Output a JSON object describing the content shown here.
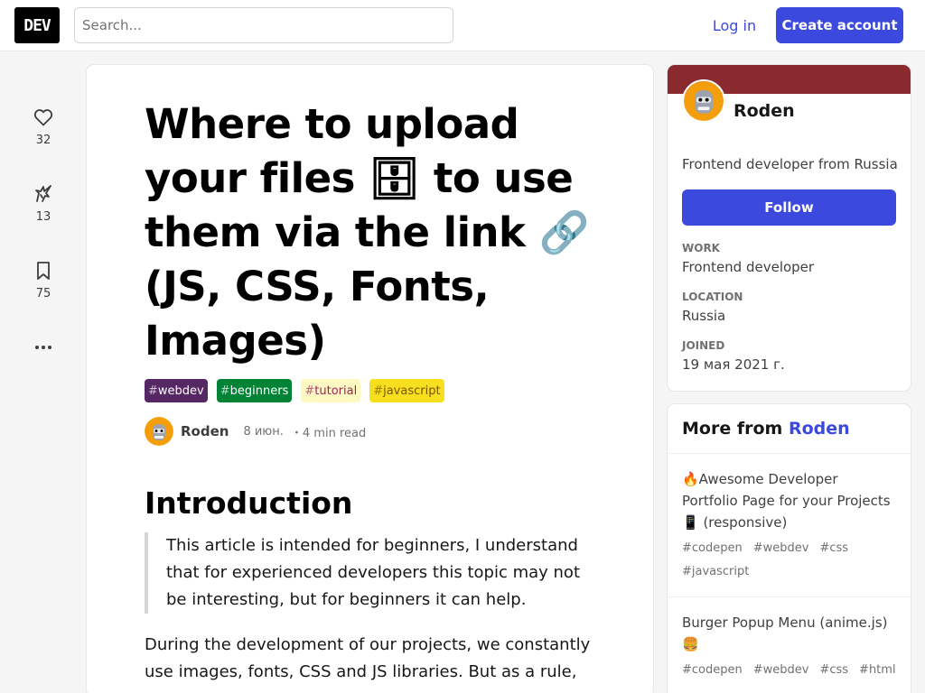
{
  "header": {
    "logo_text": "DEV",
    "search_placeholder": "Search...",
    "login_label": "Log in",
    "create_account_label": "Create account",
    "accent_color": "#3b49df"
  },
  "reactions": {
    "likes": "32",
    "unicorns": "13",
    "saves": "75"
  },
  "article": {
    "title": "Where to upload your files 🗄 to use them via the link 🔗 (JS, CSS, Fonts, Images)",
    "tags": [
      {
        "hash": "#",
        "name": "webdev",
        "bg": "#562765",
        "fg": "#ffffff"
      },
      {
        "hash": "#",
        "name": "beginners",
        "bg": "#008335",
        "fg": "#ffffff"
      },
      {
        "hash": "#",
        "name": "tutorial",
        "bg": "#fef9c3",
        "fg": "#a3225a"
      },
      {
        "hash": "#",
        "name": "javascript",
        "bg": "#f7df1e",
        "fg": "#7a5500"
      }
    ],
    "author": "Roden",
    "date": "8 июн.",
    "read_time": "・4 min read",
    "section_heading": "Introduction",
    "quote": "This article is intended for beginners, I understand that for experienced developers this topic may not be interesting, but for beginners it can help.",
    "paragraph": "During the development of our projects, we constantly use images, fonts, CSS and JS libraries. But as a rule, we"
  },
  "profile": {
    "name": "Roden",
    "bio": "Frontend developer from Russia",
    "follow_label": "Follow",
    "brand_color": "#8a2a2e",
    "work_label": "WORK",
    "work": "Frontend developer",
    "location_label": "LOCATION",
    "location": "Russia",
    "joined_label": "JOINED",
    "joined": "19 мая 2021 г."
  },
  "more_from": {
    "heading": "More from",
    "author": "Roden",
    "items": [
      {
        "title": "🔥Awesome Developer Portfolio Page for your Projects 📱 (responsive)",
        "tags": [
          "#codepen",
          "#webdev",
          "#css",
          "#javascript"
        ]
      },
      {
        "title": "Burger Popup Menu (anime.js) 🍔",
        "tags": [
          "#codepen",
          "#webdev",
          "#css",
          "#html"
        ]
      }
    ]
  }
}
